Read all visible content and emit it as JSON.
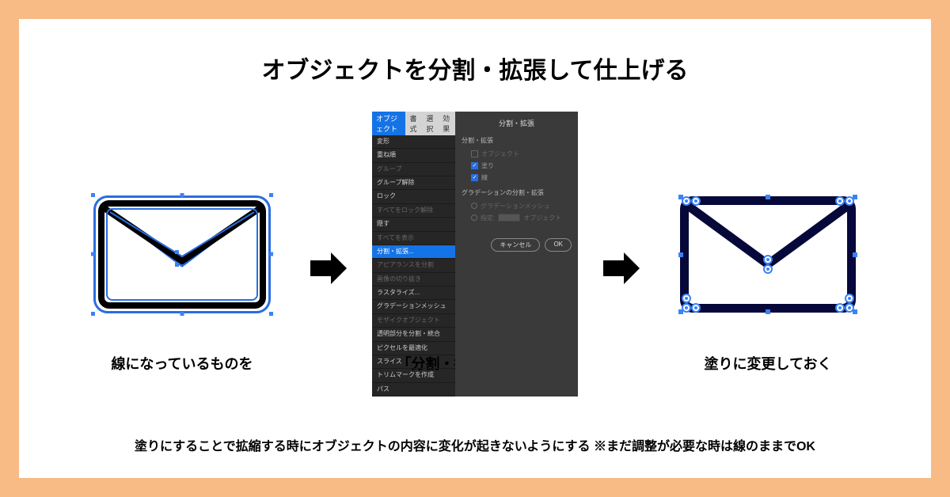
{
  "title": "オブジェクトを分割・拡張して仕上げる",
  "captions": {
    "left": "線になっているものを",
    "center": "「分割・拡張」を使って",
    "right": "塗りに変更しておく"
  },
  "bottom_note": "塗りにすることで拡縮する時にオブジェクトの内容に変化が起きないようにする ※まだ調整が必要な時は線のままでOK",
  "menu": {
    "tabs": [
      "オブジェクト",
      "書式",
      "選択",
      "効果"
    ],
    "items": [
      {
        "label": "変形",
        "hasSub": true
      },
      {
        "label": "重ね順",
        "hasSub": true
      },
      {
        "label": "グループ",
        "dimmed": true
      },
      {
        "label": "グループ解除"
      },
      {
        "label": "ロック",
        "hasSub": true
      },
      {
        "label": "すべてをロック解除",
        "dimmed": true
      },
      {
        "label": "隠す",
        "hasSub": true
      },
      {
        "label": "すべてを表示",
        "dimmed": true
      },
      {
        "label": "分割・拡張...",
        "highlighted": true
      },
      {
        "label": "アピアランスを分割",
        "dimmed": true
      },
      {
        "label": "画像の切り抜き",
        "dimmed": true
      },
      {
        "label": "ラスタライズ..."
      },
      {
        "label": "グラデーションメッシュ"
      },
      {
        "label": "モザイクオブジェクト",
        "dimmed": true
      },
      {
        "label": "透明部分を分割・統合"
      },
      {
        "label": "ピクセルを最適化"
      },
      {
        "label": "スライス",
        "hasSub": true
      },
      {
        "label": "トリムマークを作成"
      },
      {
        "label": "パス",
        "hasSub": true
      }
    ]
  },
  "dialog": {
    "title": "分割・拡張",
    "section1": "分割・拡張",
    "opt_object": "オブジェクト",
    "opt_fill": "塗り",
    "opt_stroke": "線",
    "section2": "グラデーションの分割・拡張",
    "opt_gradient": "グラデーションメッシュ",
    "opt_specify": "指定:",
    "opt_specify_unit": "オブジェクト",
    "btn_cancel": "キャンセル",
    "btn_ok": "OK"
  }
}
